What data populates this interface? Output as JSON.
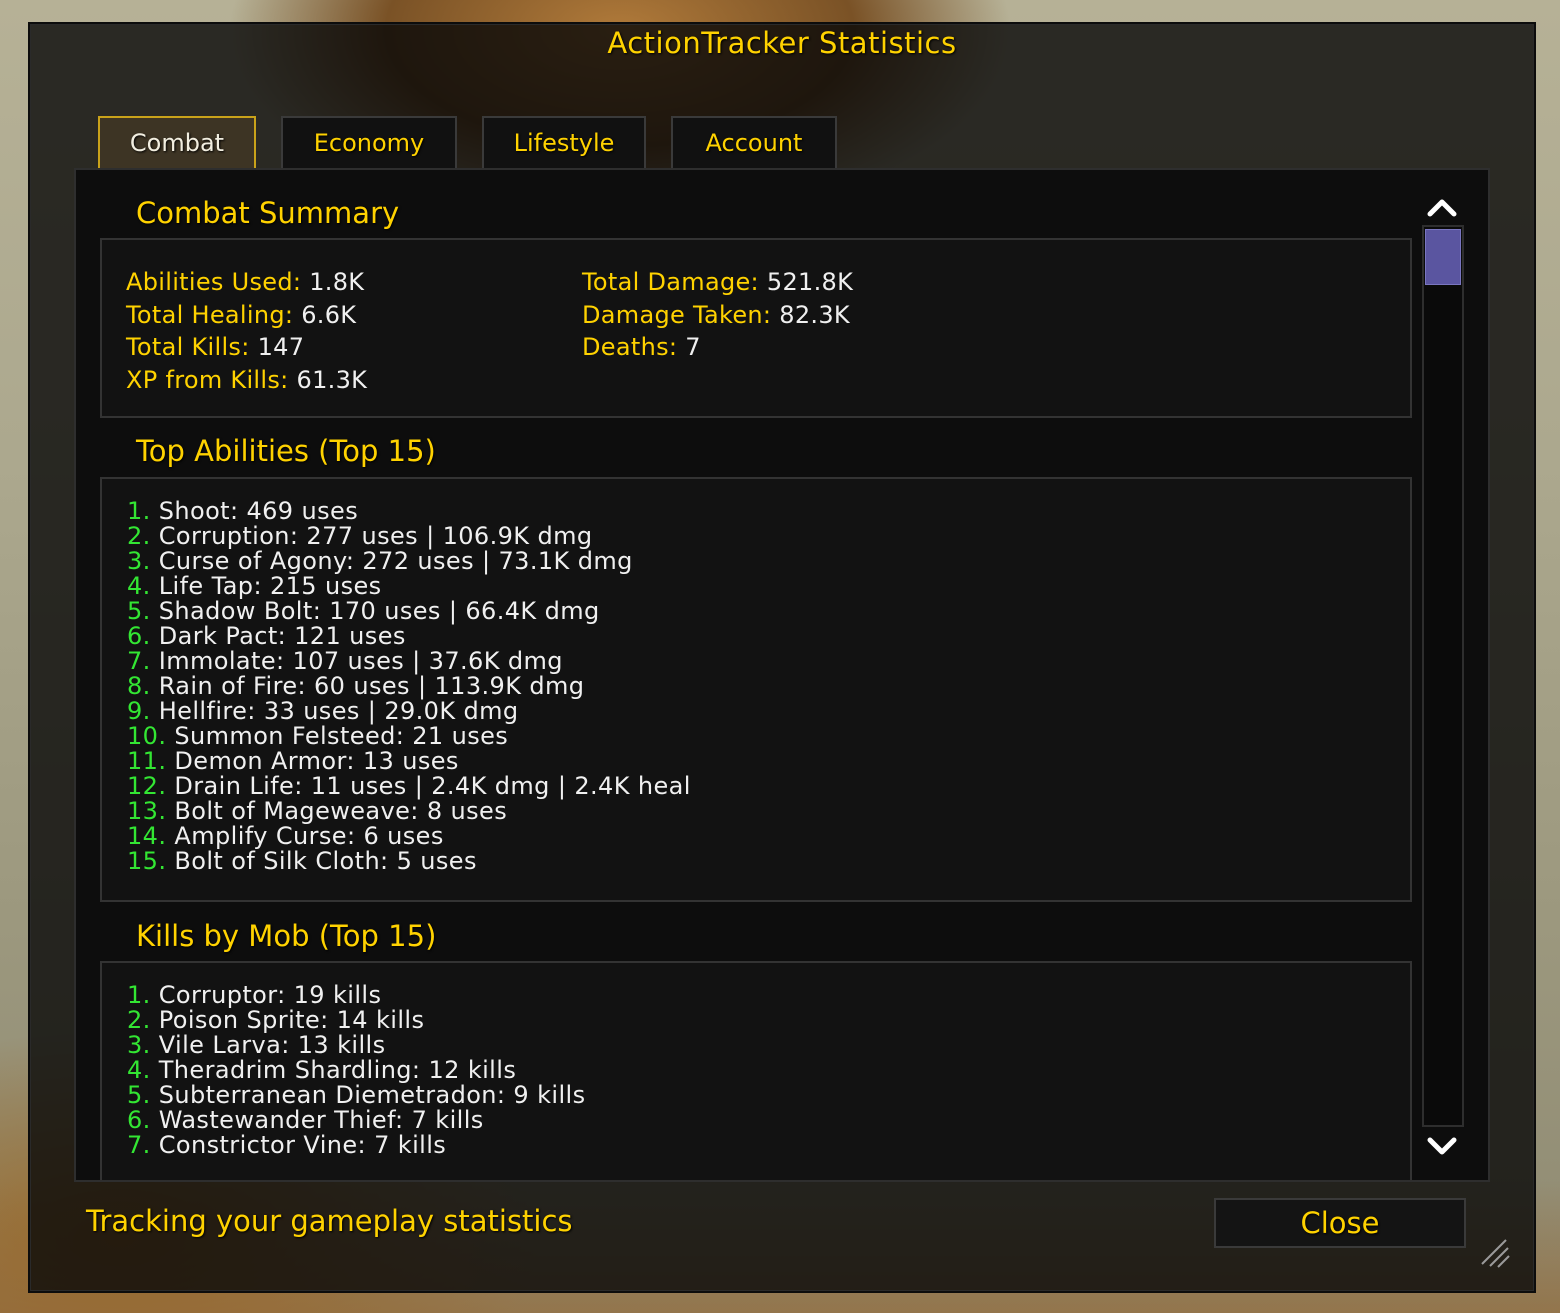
{
  "window": {
    "title": "ActionTracker Statistics",
    "tabs": [
      {
        "label": "Combat",
        "active": true
      },
      {
        "label": "Economy",
        "active": false
      },
      {
        "label": "Lifestyle",
        "active": false
      },
      {
        "label": "Account",
        "active": false
      }
    ],
    "footer_text": "Tracking your gameplay statistics",
    "close_label": "Close"
  },
  "combat_summary": {
    "heading": "Combat Summary",
    "left": [
      {
        "label": "Abilities Used:",
        "value": "1.8K"
      },
      {
        "label": "Total Healing:",
        "value": "6.6K"
      },
      {
        "label": "Total Kills:",
        "value": "147"
      },
      {
        "label": "XP from Kills:",
        "value": "61.3K"
      }
    ],
    "right": [
      {
        "label": "Total Damage:",
        "value": "521.8K"
      },
      {
        "label": "Damage Taken:",
        "value": "82.3K"
      },
      {
        "label": "Deaths:",
        "value": "7"
      }
    ]
  },
  "top_abilities": {
    "heading": "Top Abilities (Top 15)",
    "items": [
      {
        "num": "1.",
        "text": "Shoot: 469 uses"
      },
      {
        "num": "2.",
        "text": "Corruption: 277 uses | 106.9K dmg"
      },
      {
        "num": "3.",
        "text": "Curse of Agony: 272 uses | 73.1K dmg"
      },
      {
        "num": "4.",
        "text": "Life Tap: 215 uses"
      },
      {
        "num": "5.",
        "text": "Shadow Bolt: 170 uses | 66.4K dmg"
      },
      {
        "num": "6.",
        "text": "Dark Pact: 121 uses"
      },
      {
        "num": "7.",
        "text": "Immolate: 107 uses | 37.6K dmg"
      },
      {
        "num": "8.",
        "text": "Rain of Fire: 60 uses | 113.9K dmg"
      },
      {
        "num": "9.",
        "text": "Hellfire: 33 uses | 29.0K dmg"
      },
      {
        "num": "10.",
        "text": "Summon Felsteed: 21 uses"
      },
      {
        "num": "11.",
        "text": "Demon Armor: 13 uses"
      },
      {
        "num": "12.",
        "text": "Drain Life: 11 uses | 2.4K dmg | 2.4K heal"
      },
      {
        "num": "13.",
        "text": "Bolt of Mageweave: 8 uses"
      },
      {
        "num": "14.",
        "text": "Amplify Curse: 6 uses"
      },
      {
        "num": "15.",
        "text": "Bolt of Silk Cloth: 5 uses"
      }
    ]
  },
  "kills_by_mob": {
    "heading": "Kills by Mob (Top 15)",
    "items": [
      {
        "num": "1.",
        "text": "Corruptor: 19 kills"
      },
      {
        "num": "2.",
        "text": "Poison Sprite: 14 kills"
      },
      {
        "num": "3.",
        "text": "Vile Larva: 13 kills"
      },
      {
        "num": "4.",
        "text": "Theradrim Shardling: 12 kills"
      },
      {
        "num": "5.",
        "text": "Subterranean Diemetradon: 9 kills"
      },
      {
        "num": "6.",
        "text": "Wastewander Thief: 7 kills"
      },
      {
        "num": "7.",
        "text": "Constrictor Vine: 7 kills"
      }
    ]
  },
  "colors": {
    "gold": "#ffd200",
    "number_green": "#33e633",
    "scroll_thumb": "#5a55a0"
  },
  "icons": {
    "scroll_up": "chevron-up-icon",
    "scroll_down": "chevron-down-icon",
    "resize": "resize-grip-icon"
  }
}
